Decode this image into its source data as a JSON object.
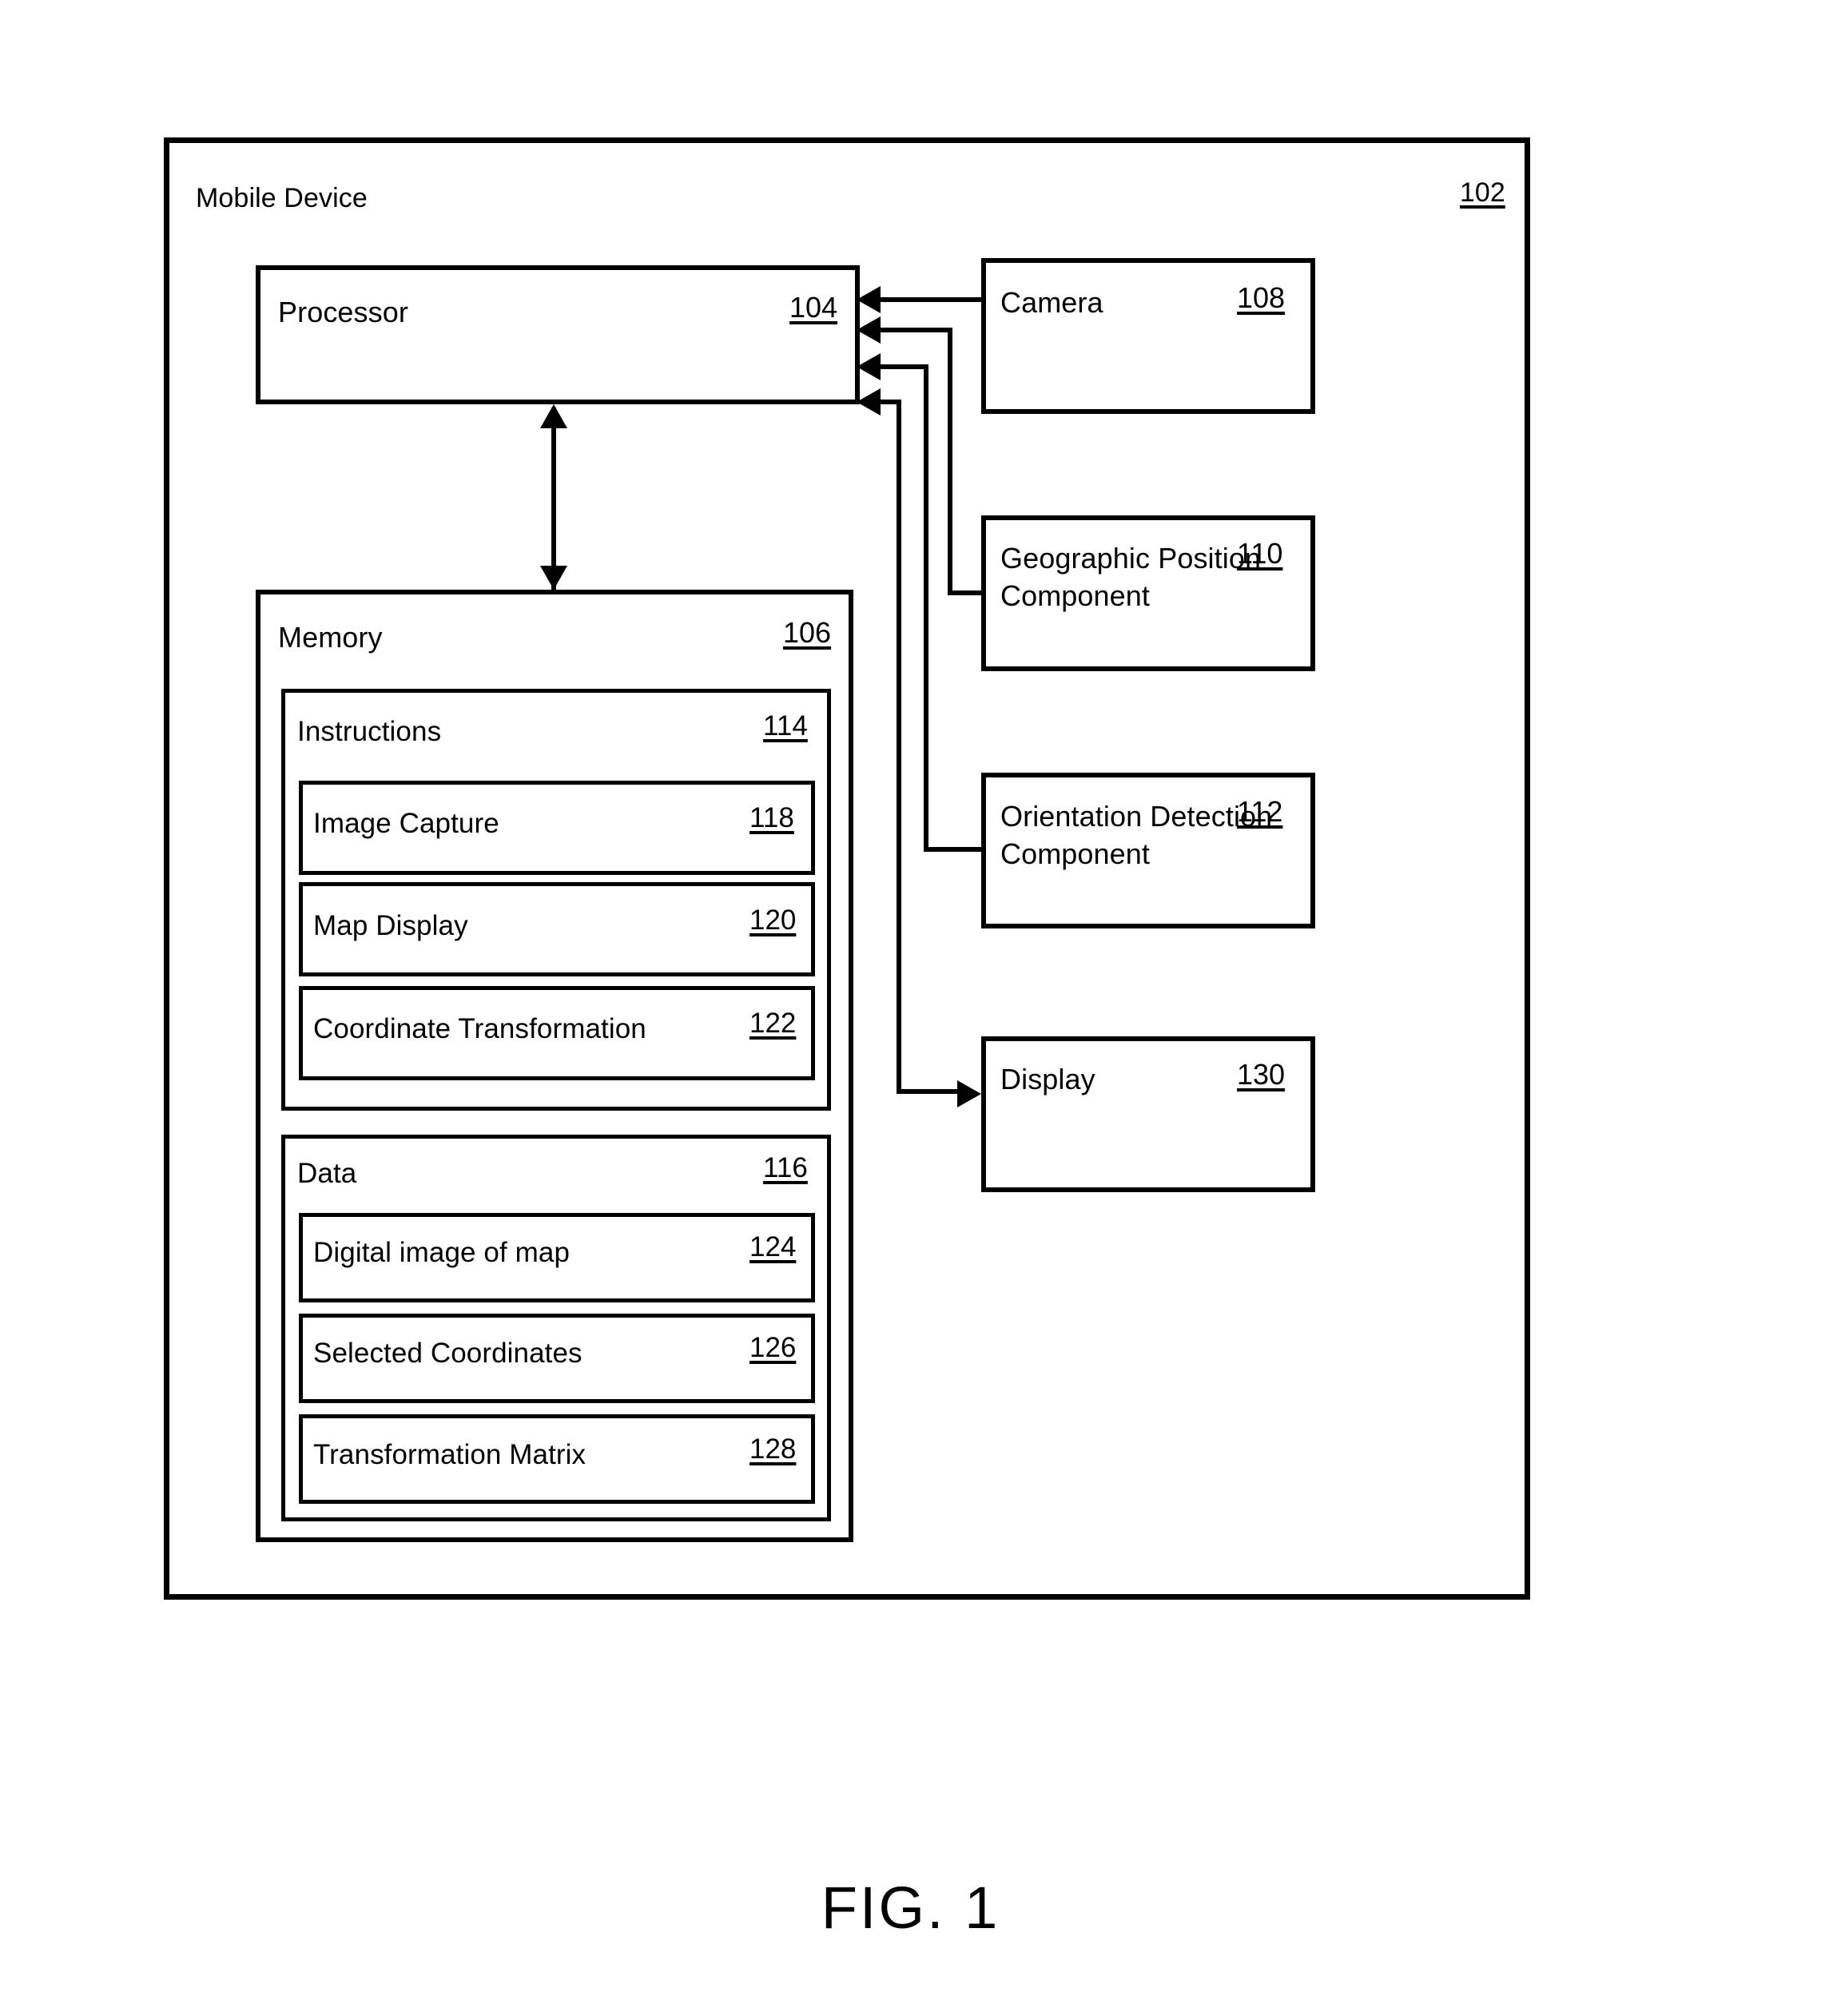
{
  "figure": {
    "caption": "FIG. 1"
  },
  "device": {
    "label": "Mobile Device",
    "ref": "102"
  },
  "processor": {
    "label": "Processor",
    "ref": "104"
  },
  "memory": {
    "label": "Memory",
    "ref": "106",
    "instructions": {
      "label": "Instructions",
      "ref": "114",
      "items": [
        {
          "label": "Image Capture",
          "ref": "118"
        },
        {
          "label": "Map Display",
          "ref": "120"
        },
        {
          "label": "Coordinate Transformation",
          "ref": "122"
        }
      ]
    },
    "data": {
      "label": "Data",
      "ref": "116",
      "items": [
        {
          "label": "Digital image of map",
          "ref": "124"
        },
        {
          "label": "Selected Coordinates",
          "ref": "126"
        },
        {
          "label": "Transformation Matrix",
          "ref": "128"
        }
      ]
    }
  },
  "peripherals": [
    {
      "label": "Camera",
      "ref": "108"
    },
    {
      "label": "Geographic Position\nComponent",
      "ref": "110"
    },
    {
      "label": "Orientation Detection\nComponent",
      "ref": "112"
    },
    {
      "label": "Display",
      "ref": "130"
    }
  ],
  "colors": {
    "stroke": "#000000",
    "fill": "#ffffff"
  }
}
